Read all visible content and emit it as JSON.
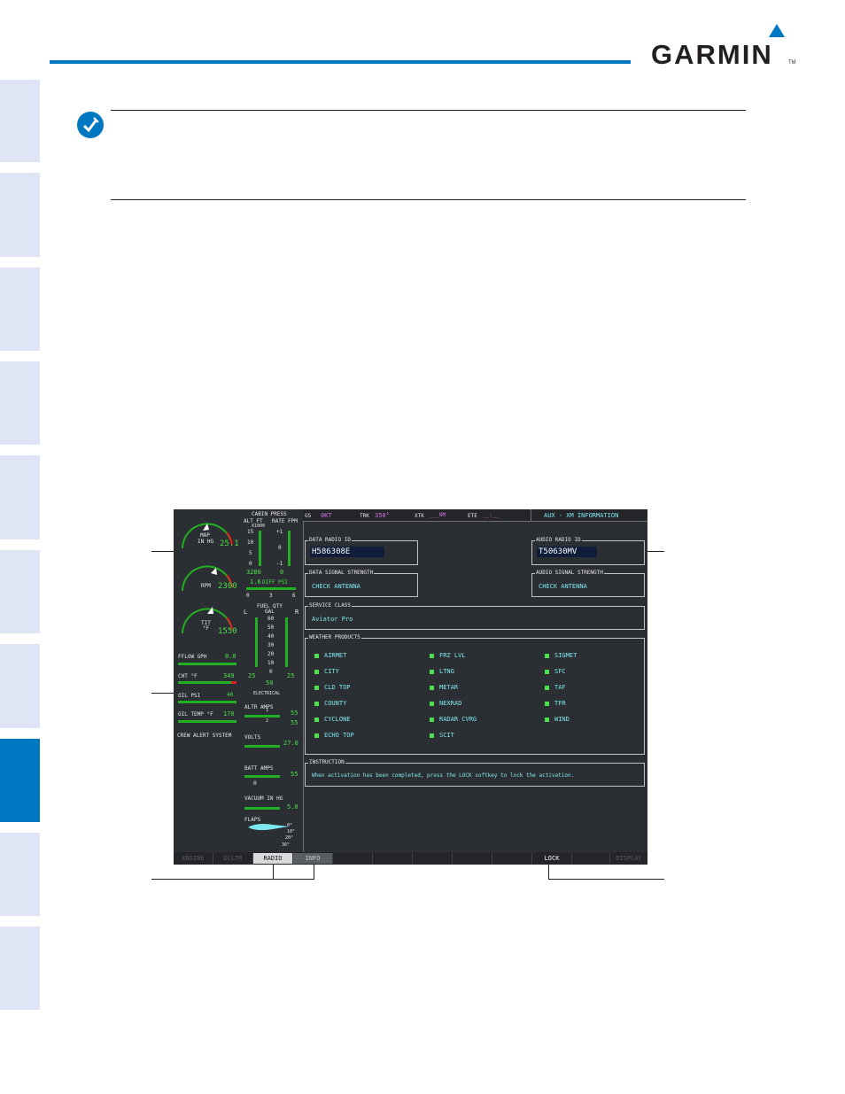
{
  "header": {
    "brand": "GARMIN",
    "trademark": "TM"
  },
  "tabs_count": 10,
  "display": {
    "topbar": {
      "gs_label": "GS",
      "gs_value": "0KT",
      "trk_label": "TRK",
      "trk_value": "350°",
      "xtk_label": "XTK",
      "xtk_value": "___NM",
      "ete_label": "ETE",
      "ete_value": "__:__",
      "page_title": "AUX - XM INFORMATION"
    },
    "eis": {
      "map_label": "MAP",
      "map_unit": "IN HG",
      "map_value": "25.1",
      "rpm_label": "RPM",
      "rpm_value": "2300",
      "tit_label": "TIT",
      "tit_unit": "°F",
      "tit_value": "1550",
      "fflow_label": "FFLOW GPH",
      "fflow_value": "0.0",
      "cht_label": "CHT °F",
      "cht_value": "349",
      "oilpsi_label": "OIL PSI",
      "oilpsi_value": "40",
      "oiltemp_label": "OIL TEMP °F",
      "oiltemp_value": "170",
      "cas_label": "CREW ALERT SYSTEM",
      "cabin_label": "CABIN PRESS",
      "alt_label": "ALT FT",
      "rate_label": "RATE FPM",
      "x1000": "X1000",
      "alt_ticks": [
        "15",
        "10",
        "5",
        "0"
      ],
      "rate_ticks": [
        "+1",
        "0",
        "-1"
      ],
      "alt_value": "3280",
      "rate_value": "0",
      "diff_value": "1.6",
      "diff_label": "DIFF PSI",
      "diff_ticks": [
        "0",
        "3",
        "6"
      ],
      "fuel_label": "FUEL QTY",
      "fuel_unit": "GAL",
      "fuel_l": "L",
      "fuel_r": "R",
      "fuel_ticks": [
        "60",
        "50",
        "40",
        "30",
        "20",
        "10",
        "0"
      ],
      "fuel_left_value": "25",
      "fuel_right_value": "25",
      "fuel_total": "50",
      "elec_label": "ELECTRICAL",
      "altr_label": "ALTR AMPS",
      "altr_v1": "55",
      "altr_v2": "55",
      "altr_marker": "1",
      "altr_marker2": "2",
      "volts_label": "VOLTS",
      "volts_value": "27.0",
      "batt_label": "BATT AMPS",
      "batt_value": "55",
      "batt_zero": "0",
      "vac_label": "VACUUM IN HG",
      "vac_value": "5.0",
      "flaps_label": "FLAPS",
      "flaps_ticks": [
        "0°",
        "10°",
        "20°",
        "36°"
      ]
    },
    "data_radio": {
      "title": "DATA RADIO ID",
      "value": "H586308E"
    },
    "audio_radio": {
      "title": "AUDIO RADIO ID",
      "value": "T50630MV"
    },
    "data_signal": {
      "title": "DATA SIGNAL STRENGTH",
      "value": "CHECK ANTENNA"
    },
    "audio_signal": {
      "title": "AUDIO SIGNAL STRENGTH",
      "value": "CHECK ANTENNA"
    },
    "service_class": {
      "title": "SERVICE CLASS",
      "value": "Aviator Pro"
    },
    "weather": {
      "title": "WEATHER PRODUCTS",
      "col1": [
        "AIRMET",
        "CITY",
        "CLD TOP",
        "COUNTY",
        "CYCLONE",
        "ECHO TOP"
      ],
      "col2": [
        "FRZ LVL",
        "LTNG",
        "METAR",
        "NEXRAD",
        "RADAR CVRG",
        "SCIT"
      ],
      "col3": [
        "SIGMET",
        "SFC",
        "TAF",
        "TFR",
        "WIND"
      ]
    },
    "instruction": {
      "title": "INSTRUCTION",
      "text": "When activation has been completed, press the LOCK softkey to lock the activation."
    },
    "softkeys": [
      "ENGINE",
      "DCLTR",
      "RADIO",
      "INFO",
      "",
      "",
      "",
      "",
      "",
      "LOCK",
      "",
      "DISPLAY"
    ]
  },
  "colors": {
    "accent_blue": "#0078c1",
    "tab_inactive": "#dfe5f4",
    "display_bg": "#2b2e32",
    "cyan_text": "#7ee8f0",
    "green_bar": "#21b021"
  }
}
